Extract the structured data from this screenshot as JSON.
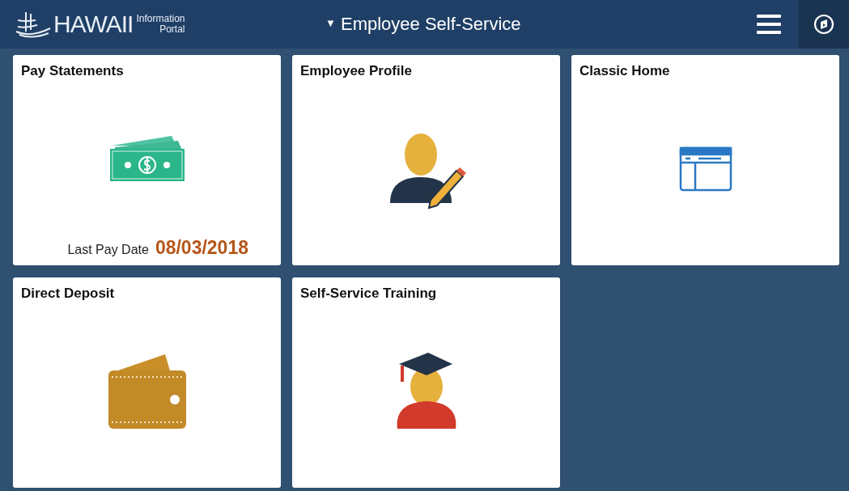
{
  "header": {
    "logo": {
      "name": "HAWAII",
      "tagline_1": "Information",
      "tagline_2": "Portal"
    },
    "menu_caret": "▼",
    "title": "Employee Self-Service"
  },
  "tiles": [
    {
      "title": "Pay Statements",
      "kind": "money",
      "footer_label": "Last Pay Date",
      "footer_value": "08/03/2018"
    },
    {
      "title": "Employee Profile",
      "kind": "profile"
    },
    {
      "title": "Classic Home",
      "kind": "window"
    },
    {
      "title": "Direct Deposit",
      "kind": "wallet"
    },
    {
      "title": "Self-Service Training",
      "kind": "graduate"
    }
  ]
}
